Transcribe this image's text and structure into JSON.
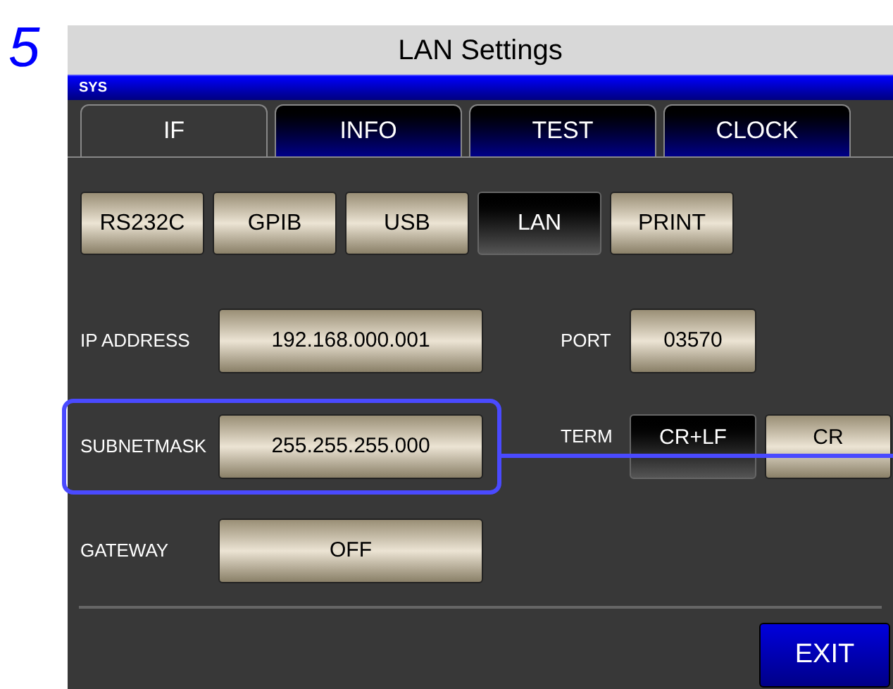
{
  "step": "5",
  "title": "LAN Settings",
  "header": "SYS",
  "tabs": [
    {
      "label": "IF",
      "selected": true
    },
    {
      "label": "INFO",
      "selected": false
    },
    {
      "label": "TEST",
      "selected": false
    },
    {
      "label": "CLOCK",
      "selected": false
    }
  ],
  "interfaces": [
    {
      "label": "RS232C",
      "selected": false
    },
    {
      "label": "GPIB",
      "selected": false
    },
    {
      "label": "USB",
      "selected": false
    },
    {
      "label": "LAN",
      "selected": true
    },
    {
      "label": "PRINT",
      "selected": false
    }
  ],
  "ip_address": {
    "label": "IP ADDRESS",
    "value": "192.168.000.001"
  },
  "port": {
    "label": "PORT",
    "value": "03570"
  },
  "subnetmask": {
    "label": "SUBNETMASK",
    "value": "255.255.255.000",
    "highlighted": true
  },
  "term": {
    "label": "TERM",
    "options": [
      {
        "label": "CR+LF",
        "selected": true
      },
      {
        "label": "CR",
        "selected": false
      }
    ]
  },
  "gateway": {
    "label": "GATEWAY",
    "value": "OFF"
  },
  "exit_button": "EXIT"
}
